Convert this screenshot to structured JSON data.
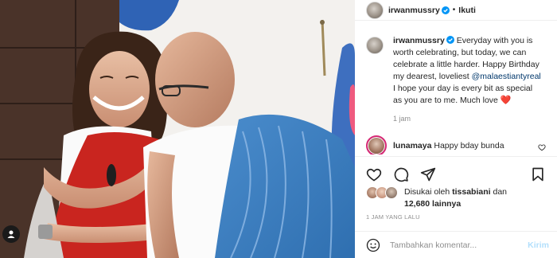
{
  "post": {
    "username": "irwanmussry",
    "separator": "•",
    "follow_label": "Ikuti"
  },
  "caption": {
    "username": "irwanmussry",
    "text_before_mention": "Everyday with you is worth celebrating, but today, we can celebrate a little harder. Happy Birthday my dearest, loveliest ",
    "mention": "@malaestiantyreal",
    "text_after_mention": " I hope your day is every bit as special as you are to me. Much love",
    "emoji": "❤️",
    "time": "1 jam"
  },
  "comments": [
    {
      "username": "lunamaya",
      "text": "Happy bday bunda"
    }
  ],
  "likes": {
    "prefix": "Disukai oleh",
    "user": "tissabiani",
    "connector": "dan",
    "count": "12,680 lainnya"
  },
  "date_text": "1 JAM YANG LALU",
  "add_comment": {
    "placeholder": "Tambahkan komentar...",
    "post_label": "Kirim"
  },
  "colors": {
    "verified": "#0095f6",
    "heart": "#ed4956",
    "link": "#00376b",
    "post_disabled": "#b2dffc"
  },
  "icons": [
    "verified-icon",
    "like-icon",
    "comment-icon",
    "share-icon",
    "save-icon",
    "emoji-icon",
    "user-tag-icon",
    "comment-like-icon"
  ]
}
